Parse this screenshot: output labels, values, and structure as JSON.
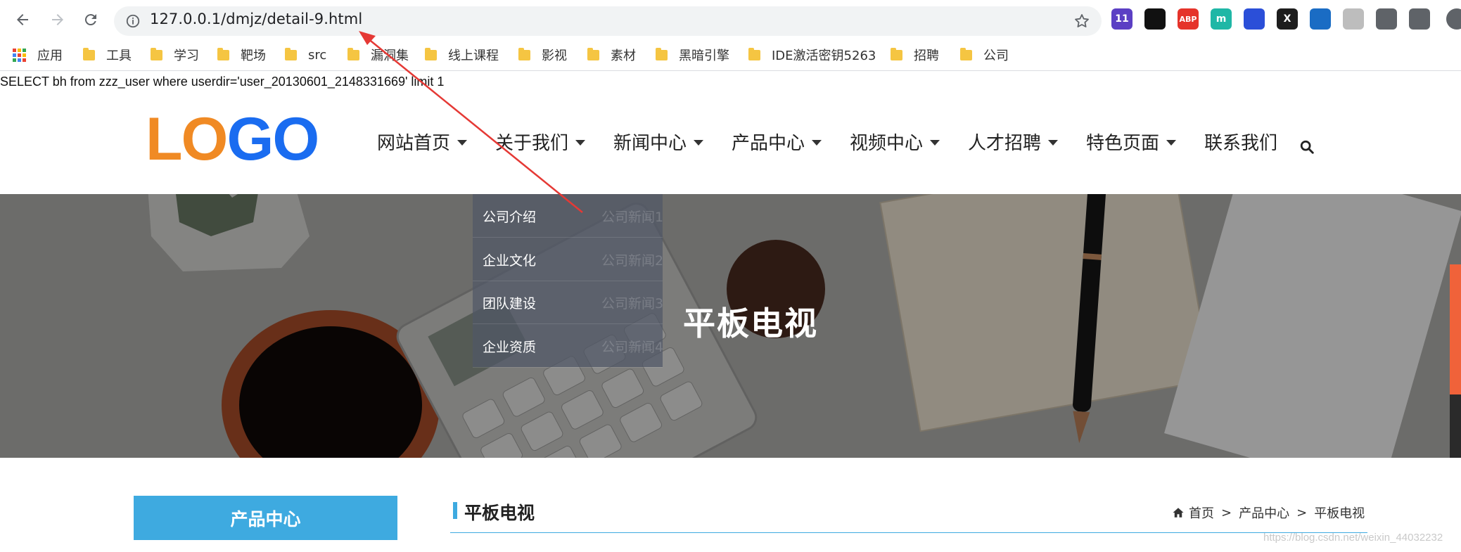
{
  "browser": {
    "url": "127.0.0.1/dmjz/detail-9.html",
    "extensions": [
      {
        "icon": "badge-ext-icon",
        "badge": "11",
        "color": "#5b3fc4"
      },
      {
        "icon": "glasses-ext-icon",
        "badge": "",
        "color": "#111111"
      },
      {
        "icon": "abp-ext-icon",
        "badge": "ABP",
        "color": "#e5332a"
      },
      {
        "icon": "m-ext-icon",
        "badge": "m",
        "color": "#1fb7a6"
      },
      {
        "icon": "paw-ext-icon",
        "badge": "",
        "color": "#2b4fd8"
      },
      {
        "icon": "x-ext-icon",
        "badge": "X",
        "color": "#1d1d1d"
      },
      {
        "icon": "translate-ext-icon",
        "badge": "",
        "color": "#1a6cc4"
      },
      {
        "icon": "ghost-ext-icon",
        "badge": "",
        "color": "#bdbdbd"
      },
      {
        "icon": "gear-ext-icon",
        "badge": "",
        "color": "#5f6368"
      },
      {
        "icon": "puzzle-icon",
        "badge": "",
        "color": "#5f6368"
      }
    ],
    "bookmarks": [
      "应用",
      "工具",
      "学习",
      "靶场",
      "src",
      "漏洞集",
      "线上课程",
      "影视",
      "素材",
      "黑暗引擎",
      "IDE激活密钥5263",
      "招聘",
      "公司"
    ]
  },
  "sql_output": "SELECT bh from zzz_user where userdir='user_20130601_2148331669' limit 1",
  "site": {
    "logo_text": [
      "L",
      "O",
      "G",
      "O"
    ],
    "logo_colors": [
      "#f08a24",
      "#f08a24",
      "#1a6cf0",
      "#1a6cf0"
    ],
    "nav": [
      {
        "label": "网站首页",
        "caret": true
      },
      {
        "label": "关于我们",
        "caret": true
      },
      {
        "label": "新闻中心",
        "caret": true
      },
      {
        "label": "产品中心",
        "caret": true
      },
      {
        "label": "视频中心",
        "caret": true
      },
      {
        "label": "人才招聘",
        "caret": true
      },
      {
        "label": "特色页面",
        "caret": true
      },
      {
        "label": "联系我们",
        "caret": false
      }
    ],
    "dropdown": [
      {
        "label": "公司介绍",
        "ghost": "公司新闻1"
      },
      {
        "label": "企业文化",
        "ghost": "公司新闻2"
      },
      {
        "label": "团队建设",
        "ghost": "公司新闻3"
      },
      {
        "label": "企业资质",
        "ghost": "公司新闻4"
      }
    ],
    "banner_title": "平板电视",
    "sidebar_heading": "产品中心",
    "section_title": "平板电视",
    "breadcrumb": {
      "home": "首页",
      "sep": ">",
      "level1": "产品中心",
      "current": "平板电视"
    },
    "watermark": "https://blog.csdn.net/weixin_44032232"
  },
  "colors": {
    "accent": "#3eaae0",
    "annotation_arrow": "#e53935"
  }
}
